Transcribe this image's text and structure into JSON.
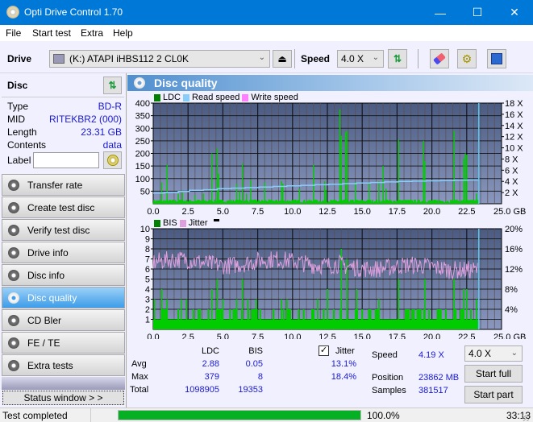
{
  "window": {
    "title": "Opti Drive Control 1.70",
    "minimize": "—",
    "maximize": "☐",
    "close": "✕"
  },
  "menu": [
    {
      "label": "File",
      "accel": "F"
    },
    {
      "label": "Start test",
      "accel": "S"
    },
    {
      "label": "Extra",
      "accel": "x"
    },
    {
      "label": "Help",
      "accel": "H"
    }
  ],
  "toolbar": {
    "drive_label": "Drive",
    "drive_value": "(K:)  ATAPI iHBS112   2 CL0K",
    "speed_label": "Speed",
    "speed_value": "4.0 X",
    "icons": [
      "eject-icon",
      "refresh-icon",
      "erase-icon",
      "settings-icon",
      "save-icon"
    ]
  },
  "disc": {
    "header": "Disc",
    "rows": [
      {
        "key": "Type",
        "value": "BD-R"
      },
      {
        "key": "MID",
        "value": "RITEKBR2 (000)"
      },
      {
        "key": "Length",
        "value": "23.31 GB"
      },
      {
        "key": "Contents",
        "value": "data"
      }
    ],
    "label_key": "Label",
    "label_value": ""
  },
  "nav": [
    {
      "label": "Transfer rate",
      "active": false
    },
    {
      "label": "Create test disc",
      "active": false
    },
    {
      "label": "Verify test disc",
      "active": false
    },
    {
      "label": "Drive info",
      "active": false
    },
    {
      "label": "Disc info",
      "active": false
    },
    {
      "label": "Disc quality",
      "active": true
    },
    {
      "label": "CD Bler",
      "active": false
    },
    {
      "label": "FE / TE",
      "active": false
    },
    {
      "label": "Extra tests",
      "active": false
    }
  ],
  "status_window_btn": "Status window > >",
  "section_title": "Disc quality",
  "chart_data": [
    {
      "type": "bar",
      "title": "LDC / Read speed",
      "legend": [
        {
          "name": "LDC",
          "color": "#008000"
        },
        {
          "name": "Read speed",
          "color": "#87cefa"
        },
        {
          "name": "Write speed",
          "color": "#ff80ff"
        }
      ],
      "xlabel": "GB",
      "xlim": [
        0,
        25
      ],
      "x_ticks": [
        "0.0",
        "2.5",
        "5.0",
        "7.5",
        "10.0",
        "12.5",
        "15.0",
        "17.5",
        "20.0",
        "22.5",
        "25.0 GB"
      ],
      "ylim": [
        0,
        400
      ],
      "y_ticks": [
        "400",
        "350",
        "300",
        "250",
        "200",
        "150",
        "100",
        "50"
      ],
      "y2lim": [
        0,
        18
      ],
      "y2_ticks": [
        "18 X",
        "16 X",
        "14 X",
        "12 X",
        "10 X",
        "8 X",
        "6 X",
        "4 X",
        "2 X"
      ],
      "data_end_gb": 23.31,
      "ldc_baseline": 12,
      "ldc_spikes": [
        [
          0.6,
          85
        ],
        [
          1.0,
          155
        ],
        [
          1.8,
          40
        ],
        [
          2.1,
          45
        ],
        [
          3.0,
          35
        ],
        [
          3.6,
          40
        ],
        [
          4.2,
          200
        ],
        [
          4.6,
          220
        ],
        [
          4.7,
          120
        ],
        [
          6.0,
          80
        ],
        [
          6.2,
          50
        ],
        [
          6.4,
          160
        ],
        [
          6.7,
          40
        ],
        [
          7.0,
          95
        ],
        [
          8.0,
          85
        ],
        [
          9.2,
          90
        ],
        [
          9.3,
          80
        ],
        [
          10.5,
          60
        ],
        [
          11.5,
          155
        ],
        [
          12.3,
          90
        ],
        [
          12.4,
          55
        ],
        [
          13.4,
          375
        ],
        [
          13.5,
          270
        ],
        [
          13.8,
          285
        ],
        [
          13.9,
          290
        ],
        [
          14.5,
          85
        ],
        [
          15.5,
          80
        ],
        [
          16.2,
          90
        ],
        [
          16.5,
          150
        ],
        [
          16.7,
          60
        ],
        [
          17.6,
          255
        ],
        [
          19.4,
          250
        ],
        [
          19.5,
          170
        ],
        [
          21.6,
          290
        ],
        [
          22.3,
          180
        ],
        [
          22.4,
          200
        ],
        [
          22.5,
          195
        ],
        [
          23.2,
          40
        ]
      ],
      "read_speed_steps": [
        [
          0.0,
          1.9
        ],
        [
          0.8,
          2.0
        ],
        [
          1.8,
          2.2
        ],
        [
          2.6,
          2.4
        ],
        [
          3.6,
          2.5
        ],
        [
          4.6,
          2.7
        ],
        [
          5.6,
          2.8
        ],
        [
          6.6,
          2.9
        ],
        [
          7.6,
          3.0
        ],
        [
          8.6,
          3.1
        ],
        [
          9.6,
          3.2
        ],
        [
          10.6,
          3.3
        ],
        [
          11.6,
          3.4
        ],
        [
          12.6,
          3.5
        ],
        [
          13.6,
          3.6
        ],
        [
          14.6,
          3.7
        ],
        [
          15.6,
          3.8
        ],
        [
          16.6,
          3.9
        ],
        [
          17.6,
          4.0
        ],
        [
          18.6,
          4.05
        ],
        [
          19.6,
          4.1
        ],
        [
          20.6,
          4.15
        ],
        [
          21.6,
          4.2
        ],
        [
          22.6,
          4.25
        ],
        [
          23.31,
          4.3
        ]
      ]
    },
    {
      "type": "bar",
      "title": "BIS / Jitter",
      "legend": [
        {
          "name": "BIS",
          "color": "#008000"
        },
        {
          "name": "Jitter",
          "color": "#dda0dd"
        }
      ],
      "xlabel": "GB",
      "xlim": [
        0,
        25
      ],
      "x_ticks": [
        "0.0",
        "2.5",
        "5.0",
        "7.5",
        "10.0",
        "12.5",
        "15.0",
        "17.5",
        "20.0",
        "22.5",
        "25.0 GB"
      ],
      "ylim": [
        0,
        10
      ],
      "y_ticks": [
        "10",
        "9",
        "8",
        "7",
        "6",
        "5",
        "4",
        "3",
        "2",
        "1"
      ],
      "y2lim": [
        0,
        20
      ],
      "y2_ticks": [
        "20%",
        "16%",
        "12%",
        "8%",
        "4%"
      ],
      "data_end_gb": 23.31,
      "bis_spikes": [
        [
          0.1,
          3
        ],
        [
          0.6,
          4
        ],
        [
          1.0,
          3
        ],
        [
          2.0,
          3
        ],
        [
          2.4,
          3
        ],
        [
          4.2,
          4
        ],
        [
          4.6,
          5
        ],
        [
          5.0,
          3
        ],
        [
          6.0,
          3
        ],
        [
          6.4,
          5
        ],
        [
          6.8,
          3
        ],
        [
          7.4,
          3
        ],
        [
          9.2,
          3
        ],
        [
          9.6,
          3
        ],
        [
          11.8,
          3
        ],
        [
          12.5,
          4
        ],
        [
          13.5,
          8
        ],
        [
          13.9,
          7
        ],
        [
          14.6,
          4
        ],
        [
          16.2,
          3
        ],
        [
          17.6,
          5
        ],
        [
          19.5,
          5
        ],
        [
          21.6,
          5
        ],
        [
          22.3,
          4
        ],
        [
          22.5,
          4
        ],
        [
          23.2,
          3
        ]
      ],
      "jitter_mean_pct": 13.1,
      "jitter_max_pct": 18.4
    }
  ],
  "stats": {
    "col_ldc": "LDC",
    "col_bis": "BIS",
    "jitter_label": "Jitter",
    "jitter_checked": true,
    "rows": [
      {
        "label": "Avg",
        "ldc": "2.88",
        "bis": "0.05",
        "jitter": "13.1%"
      },
      {
        "label": "Max",
        "ldc": "379",
        "bis": "8",
        "jitter": "18.4%"
      },
      {
        "label": "Total",
        "ldc": "1098905",
        "bis": "19353",
        "jitter": ""
      }
    ],
    "speed_label": "Speed",
    "speed_value": "4.19 X",
    "position_label": "Position",
    "position_value": "23862 MB",
    "samples_label": "Samples",
    "samples_value": "381517",
    "speed_select": "4.0 X",
    "start_full": "Start full",
    "start_part": "Start part"
  },
  "statusbar": {
    "text": "Test completed",
    "progress_pct": 100.0,
    "progress_label": "100.0%",
    "time": "33:13"
  }
}
